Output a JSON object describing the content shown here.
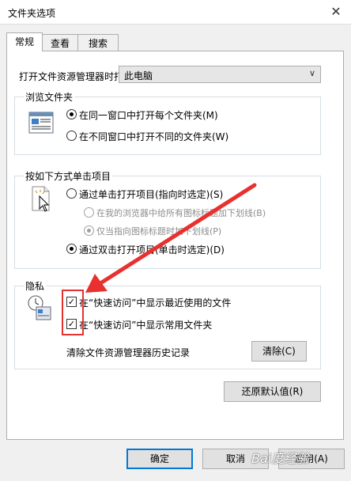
{
  "window": {
    "title": "文件夹选项",
    "close_glyph": "✕"
  },
  "tabs": [
    {
      "label": "常规"
    },
    {
      "label": "查看"
    },
    {
      "label": "搜索"
    }
  ],
  "open_explorer": {
    "label": "打开文件资源管理器时打",
    "value": "此电脑"
  },
  "browse": {
    "title": "浏览文件夹",
    "options": [
      {
        "label": "在同一窗口中打开每个文件夹(M)",
        "checked": true
      },
      {
        "label": "在不同窗口中打开不同的文件夹(W)",
        "checked": false
      }
    ]
  },
  "click": {
    "title": "按如下方式单击项目",
    "single": "通过单击打开项目(指向时选定)(S)",
    "underline_all": "在我的浏览器中给所有图标标题加下划线(B)",
    "underline_point": "仅当指向图标标题时加下划线(P)",
    "double": "通过双击打开项目(单击时选定)(D)"
  },
  "privacy": {
    "title": "隐私",
    "recent_files": "在“快速访问”中显示最近使用的文件",
    "frequent_folders": "在“快速访问”中显示常用文件夹",
    "clear_label": "清除文件资源管理器历史记录",
    "clear_button": "清除(C)"
  },
  "restore_button": "还原默认值(R)",
  "footer": {
    "ok": "确定",
    "cancel": "取消",
    "apply": "应用(A)"
  },
  "watermark": "Bai度经验",
  "accent_red": "#e8312f",
  "accent_blue": "#0078d7"
}
